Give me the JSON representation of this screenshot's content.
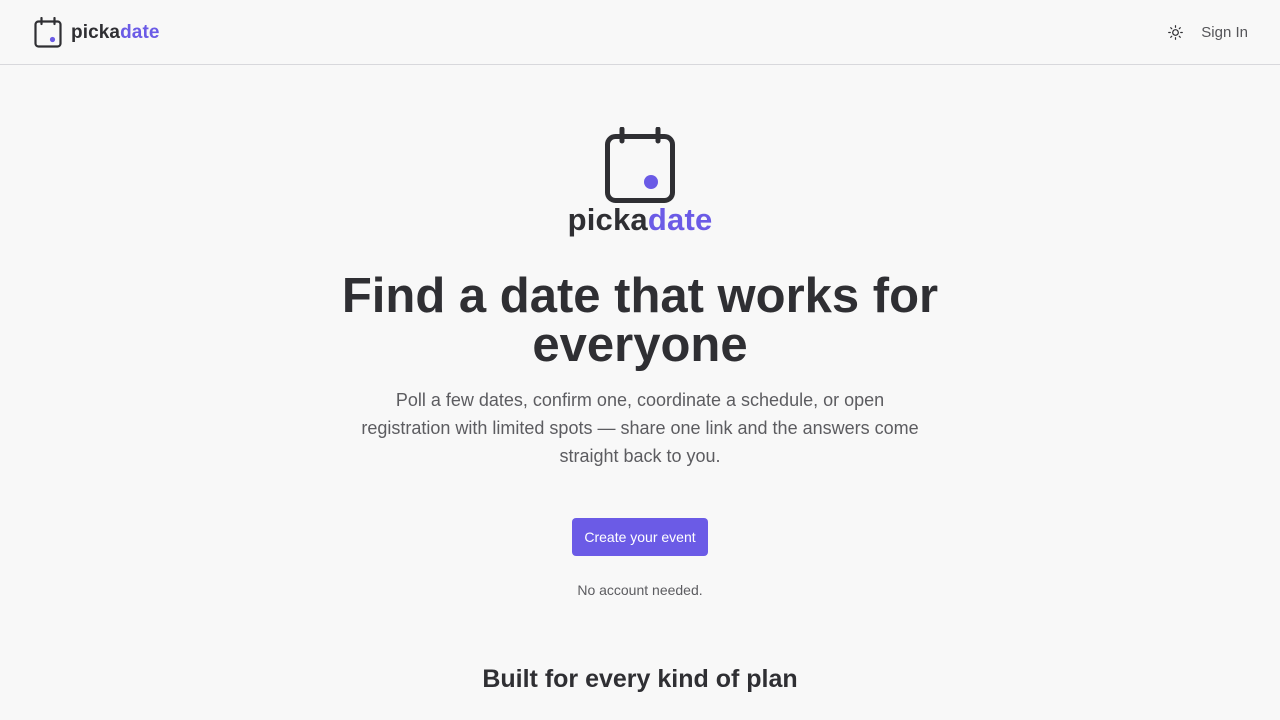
{
  "header": {
    "brand_part1": "picka",
    "brand_part2": "date",
    "theme_toggle_icon": "sun-icon",
    "signin_label": "Sign In"
  },
  "hero": {
    "logo_icon": "calendar-icon",
    "brand_part1": "picka",
    "brand_part2": "date",
    "headline": "Find a date that works for everyone",
    "subtext": "Poll a few dates, confirm one, coordinate a schedule, or open registration with limited spots — share one link and the answers come straight back to you.",
    "cta_label": "Create your event",
    "note": "No account needed."
  },
  "features": {
    "title": "Built for every kind of plan"
  },
  "colors": {
    "accent": "#6b5be6",
    "text": "#2f2f33",
    "muted": "#5c5c60",
    "background": "#f8f8f8"
  }
}
